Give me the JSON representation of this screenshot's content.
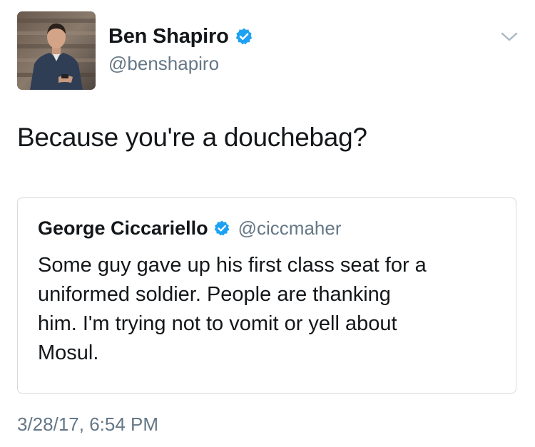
{
  "author": {
    "display_name": "Ben Shapiro",
    "handle": "@benshapiro",
    "verified": true,
    "avatar_icon": "profile-photo-avatar"
  },
  "tweet": {
    "text": "Because you're a douchebag?",
    "timestamp": "3/28/17, 6:54 PM"
  },
  "quoted_tweet": {
    "display_name": "George Ciccariello",
    "handle": "@ciccmaher",
    "verified": true,
    "text": "Some guy gave up his first class seat for a\nuniformed soldier. People are thanking\nhim. I'm trying not to vomit or yell about\nMosul."
  },
  "icons": {
    "verified": "verified-badge-icon",
    "menu": "chevron-down-icon"
  },
  "colors": {
    "verified_blue": "#1da1f2",
    "secondary_text": "#657786",
    "primary_text": "#14171a",
    "border": "#d6dbdf"
  }
}
